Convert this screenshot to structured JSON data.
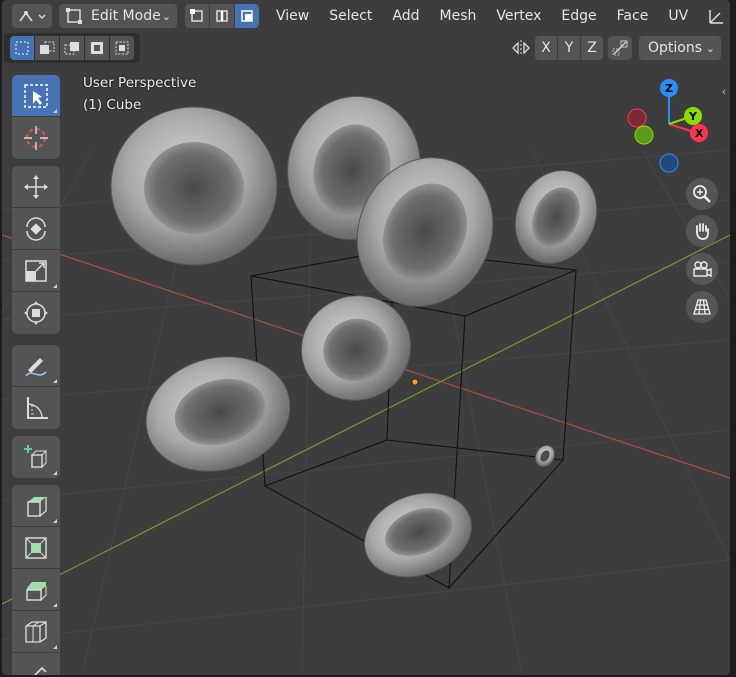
{
  "header": {
    "mode_label": "Edit Mode",
    "menus": [
      "View",
      "Select",
      "Add",
      "Mesh",
      "Vertex",
      "Edge",
      "Face",
      "UV"
    ]
  },
  "subheader": {
    "axes": [
      "X",
      "Y",
      "Z"
    ],
    "options_label": "Options"
  },
  "viewport": {
    "view_name": "User Perspective",
    "object_name": "(1) Cube"
  },
  "gizmo": {
    "x_label": "X",
    "y_label": "Y",
    "z_label": "Z",
    "colors": {
      "x": "#ff3352",
      "y": "#8bdc00",
      "z": "#2890ff"
    }
  },
  "toolbar": {
    "tools": [
      "select-box",
      "cursor",
      "move",
      "rotate",
      "scale",
      "transform",
      "annotate",
      "measure",
      "add-cube",
      "extrude-region",
      "inset-faces",
      "bevel",
      "loop-cut",
      "knife"
    ]
  },
  "colors": {
    "accent": "#4772b3",
    "viewport_bg": "#3d3d3d",
    "grid_x_axis": "#d04a4a",
    "grid_y_axis": "#6c9a2a"
  }
}
